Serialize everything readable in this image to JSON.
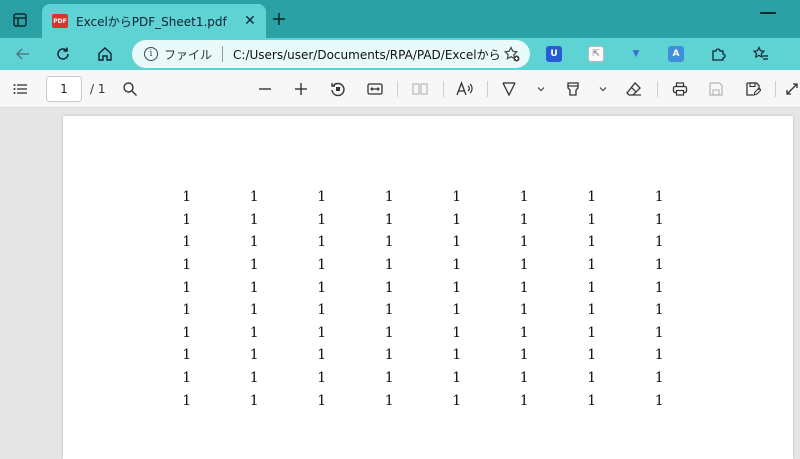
{
  "tab": {
    "title": "ExcelからPDF_Sheet1.pdf",
    "badge": "PDF",
    "close": "✕"
  },
  "omnibox": {
    "site_label": "ファイル",
    "url": "C:/Users/user/Documents/RPA/PAD/Excelから..."
  },
  "toolbar": {
    "page_number": "1",
    "page_total": "/ 1"
  },
  "extensions": [
    {
      "label": "U",
      "color": "#2a5bd7"
    },
    {
      "label": "⇱",
      "color": "#a0a0a0"
    },
    {
      "label": "▼",
      "color": "#3a6fd8"
    },
    {
      "label": "A",
      "color": "#3f8ed8"
    }
  ],
  "sheet": {
    "rows": [
      [
        "1",
        "1",
        "1",
        "1",
        "1",
        "1",
        "1",
        "1"
      ],
      [
        "1",
        "1",
        "1",
        "1",
        "1",
        "1",
        "1",
        "1"
      ],
      [
        "1",
        "1",
        "1",
        "1",
        "1",
        "1",
        "1",
        "1"
      ],
      [
        "1",
        "1",
        "1",
        "1",
        "1",
        "1",
        "1",
        "1"
      ],
      [
        "1",
        "1",
        "1",
        "1",
        "1",
        "1",
        "1",
        "1"
      ],
      [
        "1",
        "1",
        "1",
        "1",
        "1",
        "1",
        "1",
        "1"
      ],
      [
        "1",
        "1",
        "1",
        "1",
        "1",
        "1",
        "1",
        "1"
      ],
      [
        "1",
        "1",
        "1",
        "1",
        "1",
        "1",
        "1",
        "1"
      ],
      [
        "1",
        "1",
        "1",
        "1",
        "1",
        "1",
        "1",
        "1"
      ],
      [
        "1",
        "1",
        "1",
        "1",
        "1",
        "1",
        "1",
        "1"
      ]
    ]
  }
}
